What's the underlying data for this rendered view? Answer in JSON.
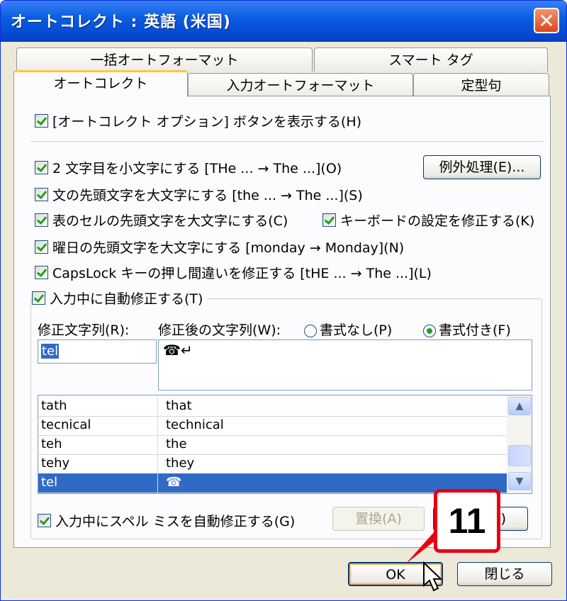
{
  "window": {
    "title": "オートコレクト : 英語 (米国)",
    "close_glyph": "✕"
  },
  "tabs": {
    "row1": [
      "一括オートフォーマット",
      "スマート タグ"
    ],
    "row2": [
      "オートコレクト",
      "入力オートフォーマット",
      "定型句"
    ],
    "active": "オートコレクト"
  },
  "options": {
    "show_buttons": "[オートコレクト オプション] ボタンを表示する(H)",
    "two_initial_caps": "2 文字目を小文字にする [THe ... → The ...](O)",
    "capitalize_sentence": "文の先頭文字を大文字にする [the ... → The ...](S)",
    "capitalize_table_cell": "表のセルの先頭文字を大文字にする(C)",
    "keyboard_setting": "キーボードの設定を修正する(K)",
    "capitalize_days": "曜日の先頭文字を大文字にする [monday →  Monday](N)",
    "caps_lock": "CapsLock キーの押し間違いを修正する [tHE ... → The ...](L)",
    "replace_as_typing": "入力中に自動修正する(T)",
    "spell_checker": "入力中にスペル ミスを自動修正する(G)"
  },
  "buttons": {
    "exceptions": "例外処理(E)...",
    "replace": "置換(A)",
    "delete_partial": ")",
    "ok": "OK",
    "close": "閉じる"
  },
  "replace_section": {
    "replace_label": "修正文字列(R):",
    "with_label": "修正後の文字列(W):",
    "plain_text": "書式なし(P)",
    "formatted_text": "書式付き(F)",
    "selected_format": "書式付き(F)",
    "replace_value": "tel",
    "with_value": "☎↵"
  },
  "entries": [
    {
      "from": "tath",
      "to": "that",
      "selected": false
    },
    {
      "from": "tecnical",
      "to": "technical",
      "selected": false
    },
    {
      "from": "teh",
      "to": "the",
      "selected": false
    },
    {
      "from": "tehy",
      "to": "they",
      "selected": false
    },
    {
      "from": "tel",
      "to": "☎",
      "selected": true
    }
  ],
  "annotation": {
    "step_number": "11"
  },
  "colors": {
    "accent": "#0a5ee3",
    "selection": "#316ac5",
    "callout": "#e60012",
    "check": "#21a121"
  }
}
